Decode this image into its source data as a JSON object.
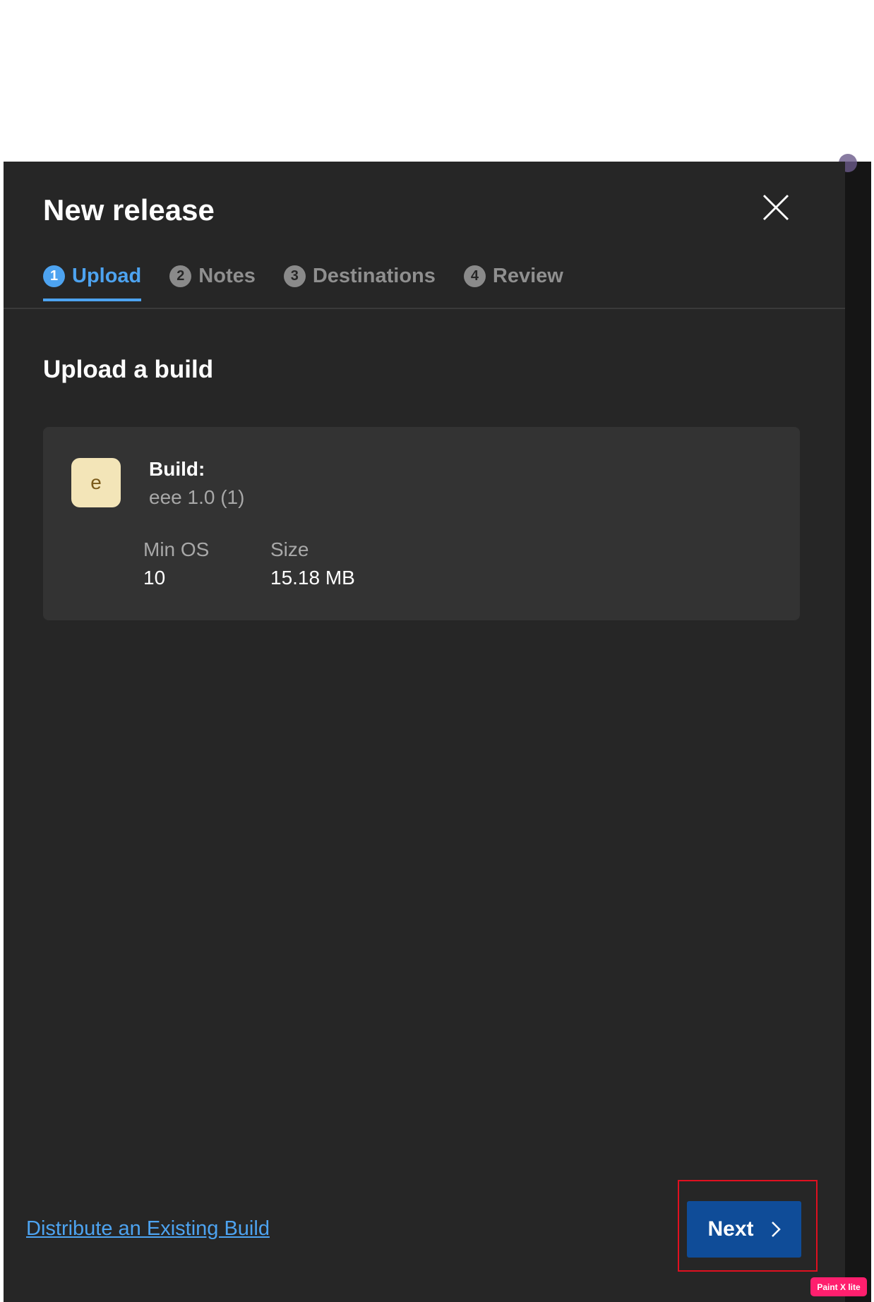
{
  "dialog": {
    "title": "New release",
    "tabs": [
      {
        "number": "1",
        "label": "Upload"
      },
      {
        "number": "2",
        "label": "Notes"
      },
      {
        "number": "3",
        "label": "Destinations"
      },
      {
        "number": "4",
        "label": "Review"
      }
    ],
    "active_tab": 0
  },
  "content": {
    "section_title": "Upload a build",
    "build": {
      "icon_letter": "e",
      "label": "Build:",
      "name": "eee 1.0 (1)",
      "min_os_label": "Min OS",
      "min_os_value": "10",
      "size_label": "Size",
      "size_value": "15.18 MB"
    }
  },
  "footer": {
    "distribute_link": "Distribute an Existing Build",
    "next_label": "Next"
  },
  "watermark": "Paint X lite",
  "colors": {
    "panel": "#262626",
    "accent": "#4da3f0",
    "primary_button": "#0f4c98",
    "highlight_box": "#e01020",
    "build_icon_bg": "#f3e5b8"
  },
  "icons": [
    "close-icon",
    "chevron-right-icon"
  ]
}
